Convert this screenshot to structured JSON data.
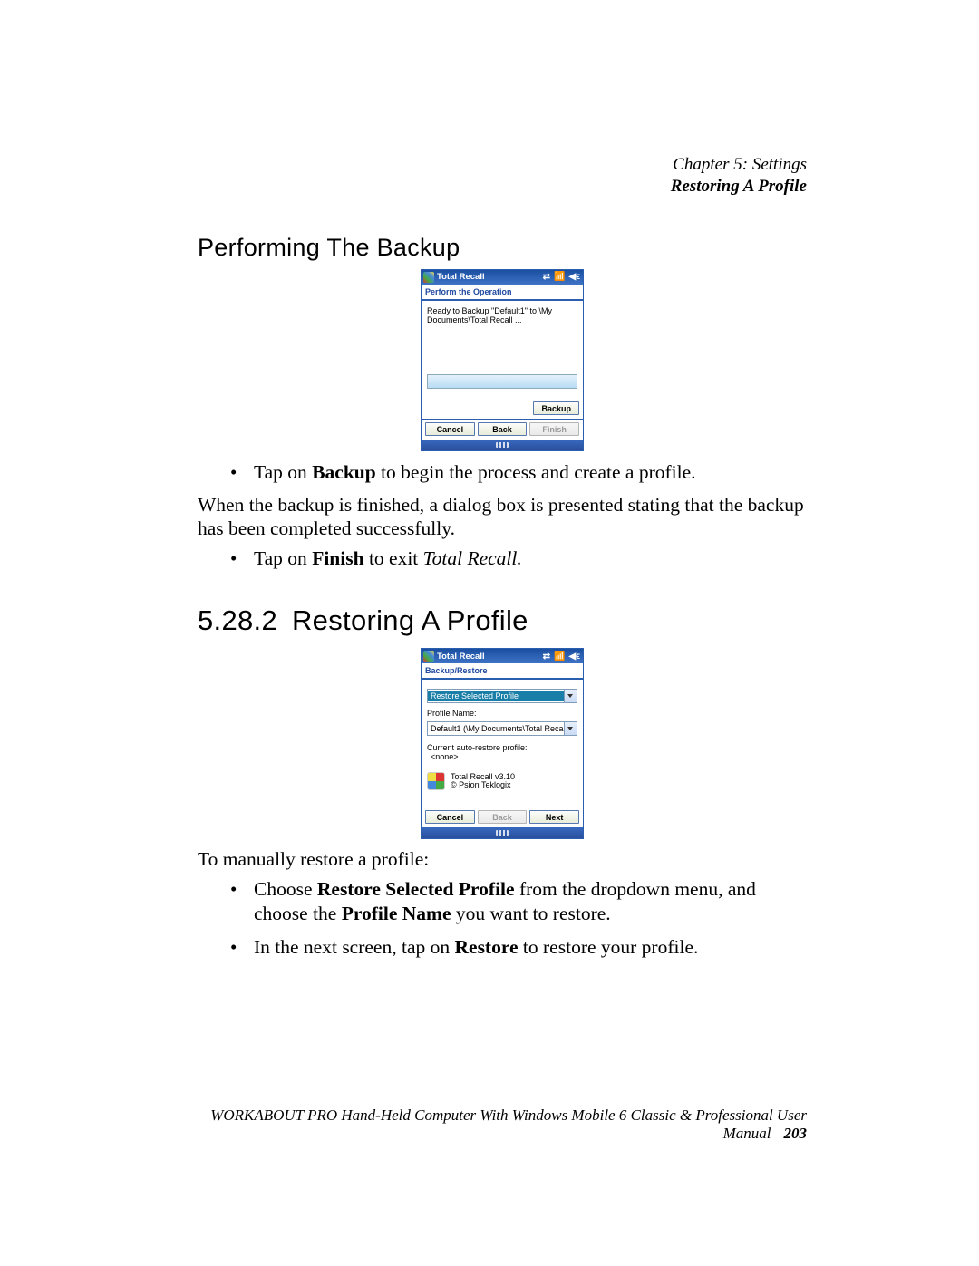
{
  "header": {
    "chapter": "Chapter 5: Settings",
    "section": "Restoring A Profile"
  },
  "headings": {
    "performing_backup": "Performing The Backup",
    "section_number": "5.28.2",
    "restoring_profile": "Restoring A Profile"
  },
  "screenshot1": {
    "title": "Total Recall",
    "caption": "Perform the Operation",
    "status": "Ready to Backup \"Default1\" to \\My Documents\\Total Recall ...",
    "buttons": {
      "backup": "Backup",
      "cancel": "Cancel",
      "back": "Back",
      "finish": "Finish"
    }
  },
  "text_after_ss1": {
    "bullet1a": "Tap on ",
    "bullet1b": "Backup",
    "bullet1c": " to begin the process and create a profile.",
    "para1": "When the backup is finished, a dialog box is presented stating that the backup has been completed successfully.",
    "bullet2a": "Tap on ",
    "bullet2b": "Finish",
    "bullet2c": " to exit ",
    "bullet2d": "Total Recall."
  },
  "screenshot2": {
    "title": "Total Recall",
    "caption": "Backup/Restore",
    "select1": "Restore Selected Profile",
    "label1": "Profile Name:",
    "select2": "Default1 (\\My Documents\\Total Recal",
    "label2": "Current auto-restore profile:",
    "label2_val": "<none>",
    "branding_line1": "Total Recall v3.10",
    "branding_line2": "© Psion Teklogix",
    "buttons": {
      "cancel": "Cancel",
      "back": "Back",
      "next": "Next"
    }
  },
  "text_after_ss2": {
    "para1": "To manually restore a profile:",
    "b1a": "Choose ",
    "b1b": "Restore Selected Profile",
    "b1c": " from the dropdown menu, and choose the ",
    "b1d": "Profile Name",
    "b1e": " you want to restore.",
    "b2a": "In the next screen, tap on ",
    "b2b": "Restore",
    "b2c": " to restore your profile."
  },
  "footer": {
    "text": "WORKABOUT PRO Hand-Held Computer With Windows Mobile 6 Classic & Professional User Manual",
    "page": "203"
  }
}
